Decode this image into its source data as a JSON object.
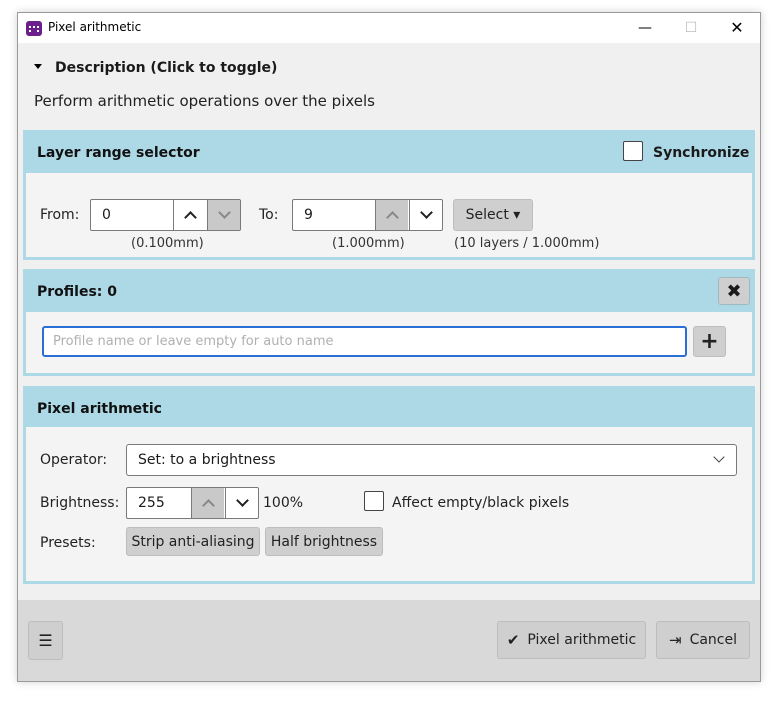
{
  "window": {
    "title": "Pixel arithmetic",
    "min_glyph": "—",
    "max_glyph": "☐",
    "close_glyph": "✕"
  },
  "description": {
    "toggle_label": "Description (Click to toggle)",
    "text": "Perform arithmetic operations over the pixels"
  },
  "layer_range": {
    "title": "Layer range selector",
    "synchronize_label": "Synchronize",
    "synchronize_checked": false,
    "from_label": "From:",
    "from_value": "0",
    "from_sub": "(0.100mm)",
    "to_label": "To:",
    "to_value": "9",
    "to_sub": "(1.000mm)",
    "select_label": "Select ▾",
    "range_info": "(10 layers / 1.000mm)"
  },
  "profiles": {
    "title": "Profiles: 0",
    "clear_glyph": "✖",
    "input_value": "",
    "input_placeholder": "Profile name or leave empty for auto name",
    "add_glyph": "+"
  },
  "pixel_arithmetic": {
    "title": "Pixel arithmetic",
    "operator_label": "Operator:",
    "operator_value": "Set: to a brightness",
    "brightness_label": "Brightness:",
    "brightness_value": "255",
    "brightness_percent": "100%",
    "affect_empty_label": "Affect empty/black pixels",
    "affect_empty_checked": false,
    "presets_label": "Presets:",
    "presets": [
      "Strip anti-aliasing",
      "Half brightness"
    ]
  },
  "footer": {
    "menu_glyph": "☰",
    "ok_icon": "✔",
    "ok_label": "Pixel arithmetic",
    "cancel_icon": "⇥",
    "cancel_label": "Cancel"
  },
  "colors": {
    "panel_header": "#add8e6",
    "focus_border": "#2a6fd6",
    "app_icon": "#6b1f8c"
  }
}
